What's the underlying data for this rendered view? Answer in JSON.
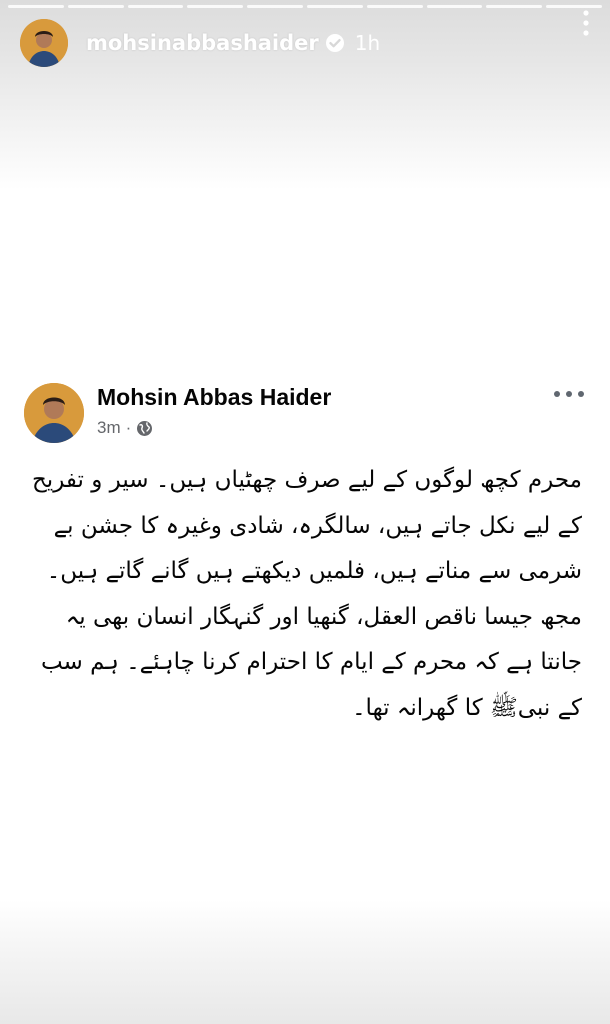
{
  "story": {
    "username": "mohsinabbashaider",
    "time": "1h",
    "segments": 10
  },
  "post": {
    "author": "Mohsin Abbas Haider",
    "time": "3m",
    "separator": "·",
    "text": "محرم کچھ لوگوں کے لیے صرف چھٹیاں ہیں۔ سیر و تفریح کے لیے نکل جاتے ہیں، سالگرہ، شادی وغیرہ کا جشن بے شرمی سے مناتے ہیں، فلمیں دیکھتے ہیں گانے گاتے ہیں۔ مجھ جیسا ناقص العقل، گنھیا اور گنہگار انسان بھی یہ جانتا ہے کہ محرم کے ایام کا احترام کرنا چاہئے۔ ہم سب کے نبیﷺ کا گھرانہ تھا۔"
  },
  "icons": {
    "verified": "verified-badge-icon",
    "story_more": "vertical-dots-icon",
    "globe": "globe-icon",
    "post_more": "horizontal-dots-icon"
  },
  "colors": {
    "author_text": "#050505",
    "meta_text": "#65676b",
    "avatar_bg": "#d89a3c"
  }
}
